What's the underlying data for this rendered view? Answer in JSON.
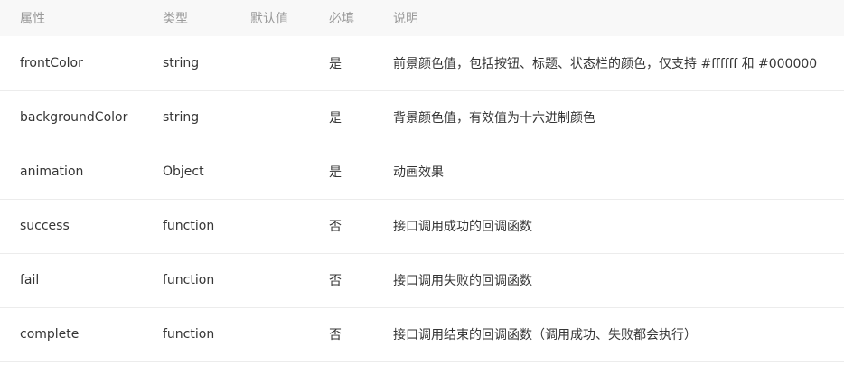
{
  "table": {
    "headers": [
      "属性",
      "类型",
      "默认值",
      "必填",
      "说明"
    ],
    "rows": [
      {
        "attr": "frontColor",
        "type": "string",
        "default": "",
        "required": "是",
        "desc": "前景颜色值，包括按钮、标题、状态栏的颜色，仅支持 #ffffff 和 #000000"
      },
      {
        "attr": "backgroundColor",
        "type": "string",
        "default": "",
        "required": "是",
        "desc": "背景颜色值，有效值为十六进制颜色"
      },
      {
        "attr": "animation",
        "type": "Object",
        "default": "",
        "required": "是",
        "desc": "动画效果"
      },
      {
        "attr": "success",
        "type": "function",
        "default": "",
        "required": "否",
        "desc": "接口调用成功的回调函数"
      },
      {
        "attr": "fail",
        "type": "function",
        "default": "",
        "required": "否",
        "desc": "接口调用失败的回调函数"
      },
      {
        "attr": "complete",
        "type": "function",
        "default": "",
        "required": "否",
        "desc": "接口调用结束的回调函数（调用成功、失败都会执行）"
      }
    ]
  }
}
